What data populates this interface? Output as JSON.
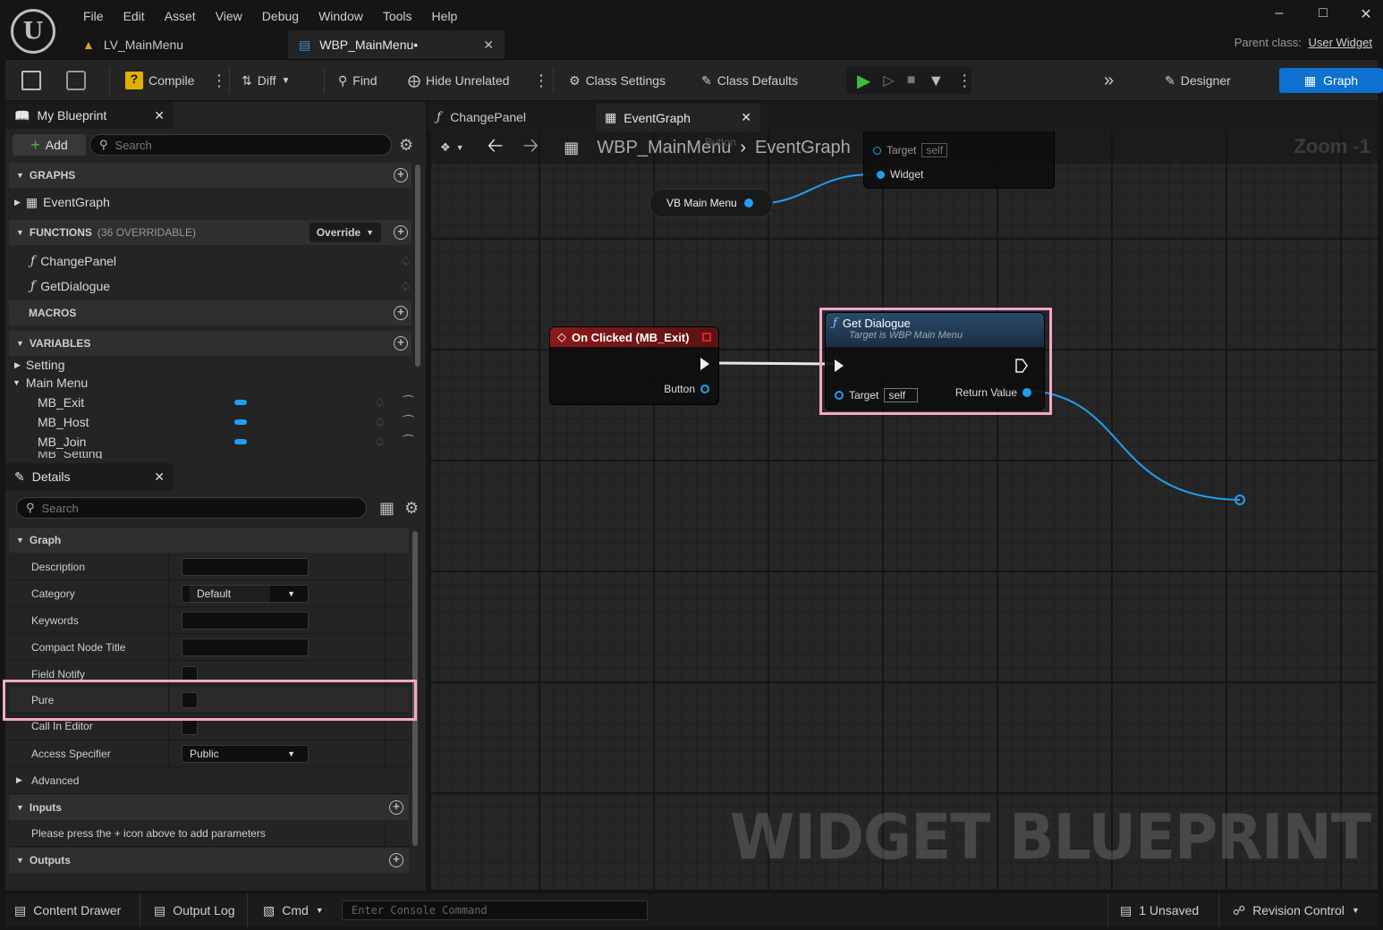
{
  "menu": [
    "File",
    "Edit",
    "Asset",
    "View",
    "Debug",
    "Window",
    "Tools",
    "Help"
  ],
  "doc_tabs": [
    {
      "label": "LV_MainMenu"
    },
    {
      "label": "WBP_MainMenu•"
    }
  ],
  "parent_class": {
    "label": "Parent class:",
    "value": "User Widget"
  },
  "toolbar": {
    "compile": "Compile",
    "diff": "Diff",
    "find": "Find",
    "hide_unrelated": "Hide Unrelated",
    "class_settings": "Class Settings",
    "class_defaults": "Class Defaults",
    "designer": "Designer",
    "graph": "Graph"
  },
  "my_blueprint": {
    "tab": "My Blueprint",
    "add": "Add",
    "search_placeholder": "Search",
    "graphs_header": "GRAPHS",
    "event_graph": "EventGraph",
    "functions_header": "FUNCTIONS",
    "functions_count": "(36 OVERRIDABLE)",
    "override": "Override",
    "functions": [
      "ChangePanel",
      "GetDialogue"
    ],
    "macros_header": "MACROS",
    "variables_header": "VARIABLES",
    "categories": [
      "Setting",
      "Main Menu"
    ],
    "variables": [
      "MB_Exit",
      "MB_Host",
      "MB_Join",
      "MB_Setting"
    ]
  },
  "details": {
    "tab": "Details",
    "search_placeholder": "Search",
    "graph_section": "Graph",
    "rows": {
      "description": "Description",
      "category": "Category",
      "category_value": "Default",
      "keywords": "Keywords",
      "compact": "Compact Node Title",
      "field_notify": "Field Notify",
      "pure": "Pure",
      "call_in_editor": "Call In Editor",
      "access": "Access Specifier",
      "access_value": "Public",
      "advanced": "Advanced"
    },
    "inputs": "Inputs",
    "inputs_hint": "Please press the + icon above to add parameters",
    "outputs": "Outputs"
  },
  "graph_tabs": [
    "ChangePanel",
    "EventGraph"
  ],
  "breadcrumb": {
    "root": "WBP_MainMenu",
    "current": "EventGraph"
  },
  "zoom": "Zoom -1",
  "nodes": {
    "top_partial": {
      "pin_target": "Target",
      "pin_self": "self",
      "pin_widget": "Widget",
      "ghost": "Button"
    },
    "vb_main_menu": "VB Main Menu",
    "on_clicked": {
      "title": "On Clicked (MB_Exit)",
      "pin_button": "Button"
    },
    "get_dialogue": {
      "title": "Get Dialogue",
      "subtitle": "Target is WBP Main Menu",
      "target": "Target",
      "self": "self",
      "return": "Return Value"
    }
  },
  "watermark": "WIDGET BLUEPRINT",
  "status": {
    "content_drawer": "Content Drawer",
    "output_log": "Output Log",
    "cmd": "Cmd",
    "console_placeholder": "Enter Console Command",
    "unsaved": "1 Unsaved",
    "revision": "Revision Control"
  },
  "colors": {
    "accent": "#0e70d1",
    "highlight": "#f4a8c7",
    "object_pin": "#1f9ff2",
    "event_header": "#8a1a1a",
    "function_header": "#1f3e5c"
  }
}
